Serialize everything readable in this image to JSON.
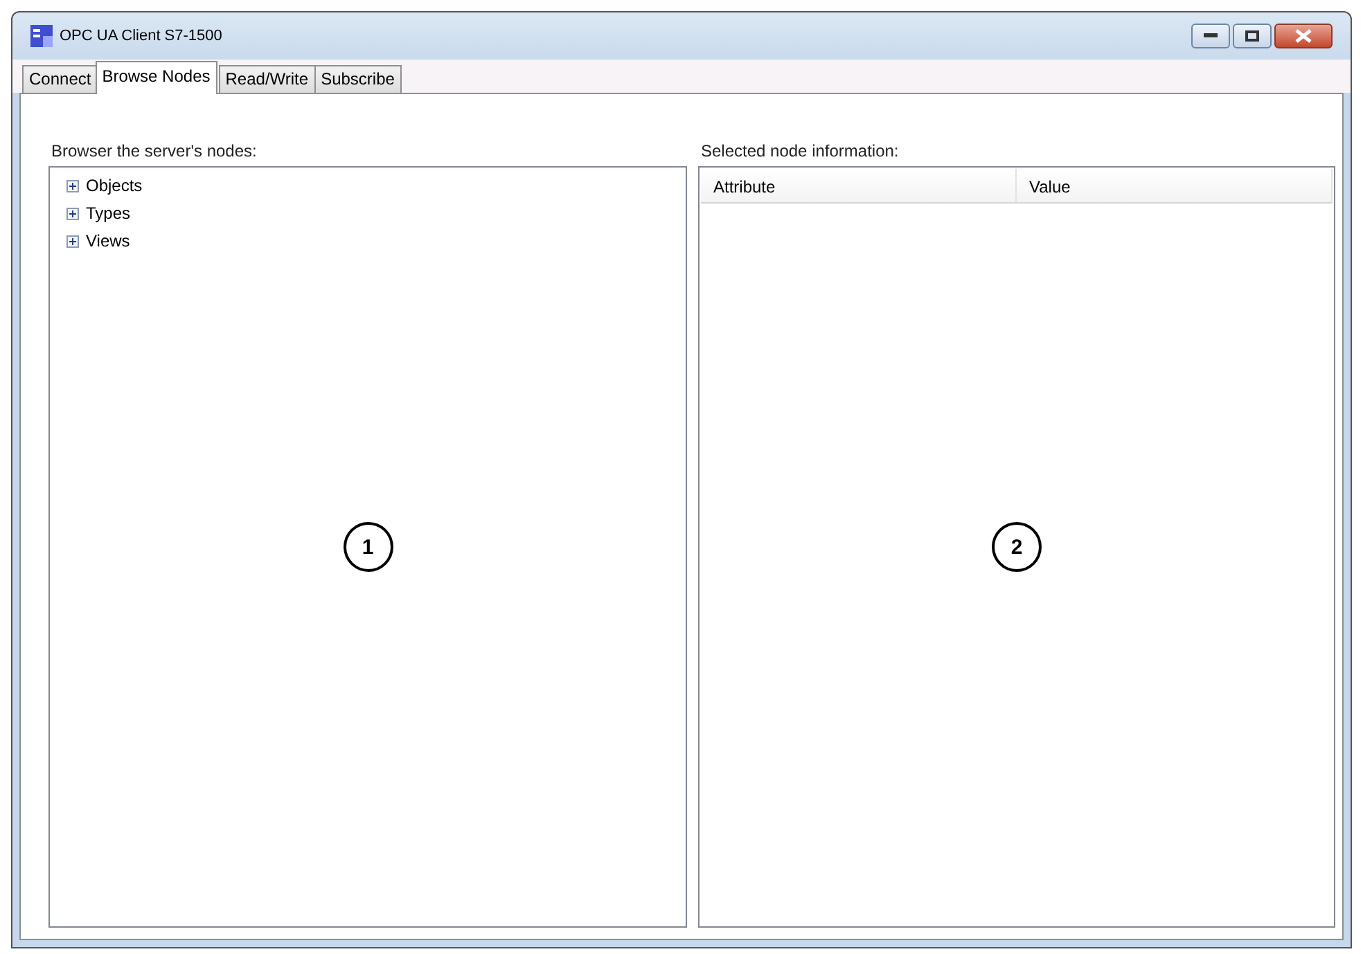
{
  "window": {
    "title": "OPC UA Client S7-1500"
  },
  "tabs": [
    {
      "label": "Connect",
      "selected": false
    },
    {
      "label": "Browse Nodes",
      "selected": true
    },
    {
      "label": "Read/Write",
      "selected": false
    },
    {
      "label": "Subscribe",
      "selected": false
    }
  ],
  "browser": {
    "label": "Browser the server's nodes:",
    "callout": "1",
    "nodes": [
      {
        "label": "Objects",
        "expanded": false
      },
      {
        "label": "Types",
        "expanded": false
      },
      {
        "label": "Views",
        "expanded": false
      }
    ]
  },
  "node_info": {
    "label": "Selected node information:",
    "callout": "2",
    "columns": [
      "Attribute",
      "Value"
    ]
  }
}
